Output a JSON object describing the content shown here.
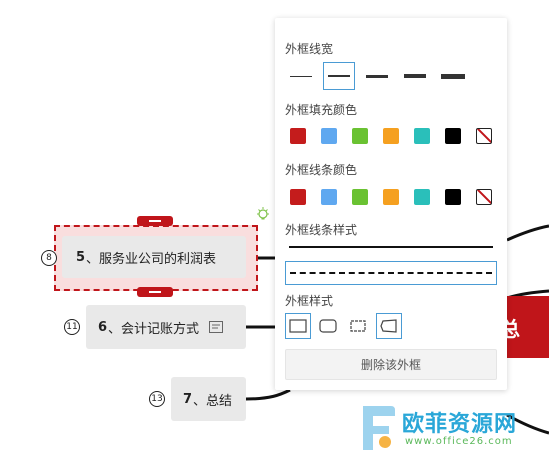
{
  "mindmap": {
    "nodes": [
      {
        "badge": "8",
        "num": "5",
        "text": "、服务业公司的利润表"
      },
      {
        "badge": "11",
        "num": "6",
        "text": "、会计记账方式"
      },
      {
        "badge": "13",
        "num": "7",
        "text": "、总结"
      }
    ],
    "root_text": "总"
  },
  "panel": {
    "line_width_title": "外框线宽",
    "fill_color_title": "外框填充颜色",
    "stroke_color_title": "外框线条颜色",
    "line_style_title": "外框线条样式",
    "frame_style_title": "外框样式",
    "delete_label": "删除该外框",
    "colors": [
      "#c41c1c",
      "#5fa8f0",
      "#6ac232",
      "#f5a020",
      "#2abfba",
      "#000000"
    ],
    "accent_color": "#4a9bd4"
  },
  "watermark": {
    "text": "欧菲资源网",
    "url": "www.office26.com"
  }
}
